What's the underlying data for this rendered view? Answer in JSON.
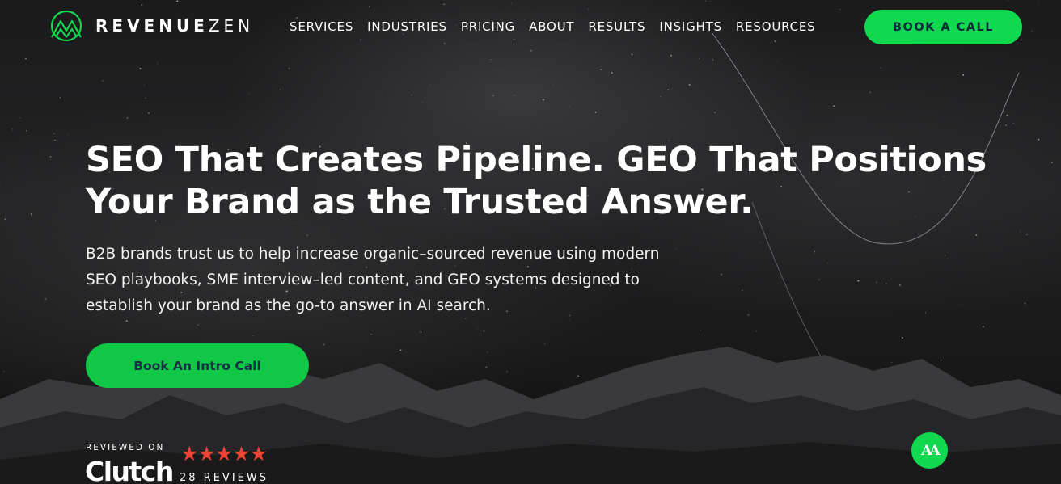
{
  "brand": {
    "name_bold": "REVENUE",
    "name_light": "ZEN",
    "accent": "#10d84f"
  },
  "nav": {
    "items": [
      {
        "label": "SERVICES"
      },
      {
        "label": "INDUSTRIES"
      },
      {
        "label": "PRICING"
      },
      {
        "label": "ABOUT"
      },
      {
        "label": "RESULTS"
      },
      {
        "label": "INSIGHTS"
      },
      {
        "label": "RESOURCES"
      }
    ],
    "cta_label": "BOOK A CALL"
  },
  "hero": {
    "headline": "SEO That Creates Pipeline. GEO That Positions Your Brand as the Trusted Answer.",
    "subtext": "B2B brands trust us to help increase organic–sourced revenue using modern SEO playbooks, SME interview–led content, and GEO systems designed to establish your brand as the go-to answer in AI search.",
    "cta_label": "Book An Intro Call"
  },
  "clutch": {
    "reviewed_on": "REVIEWED ON",
    "name": "Clutch",
    "rating_stars": 5,
    "stars": "★★★★★",
    "reviews": "28 REVIEWS",
    "star_color": "#ef4335"
  },
  "accessibility": {
    "label": "AA",
    "icon": "accessibility-icon"
  }
}
